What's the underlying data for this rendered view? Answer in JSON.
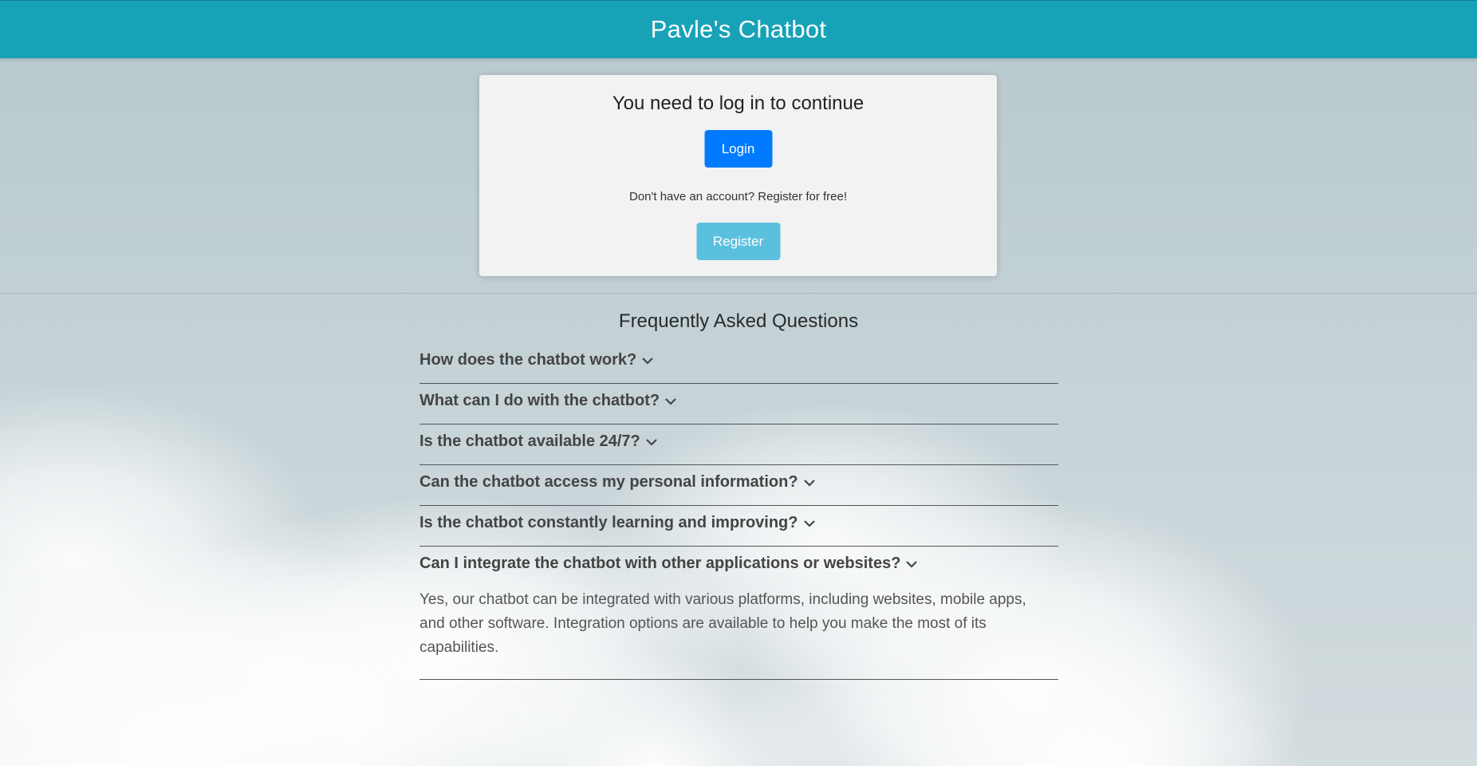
{
  "header": {
    "title": "Pavle's Chatbot",
    "color": "#17a2b8"
  },
  "login_card": {
    "heading": "You need to log in to continue",
    "login_label": "Login",
    "register_prompt": "Don't have an account? Register for free!",
    "register_label": "Register"
  },
  "faq": {
    "title": "Frequently Asked Questions",
    "items": [
      {
        "question": "How does the chatbot work?",
        "expanded": false
      },
      {
        "question": "What can I do with the chatbot?",
        "expanded": false
      },
      {
        "question": "Is the chatbot available 24/7?",
        "expanded": false
      },
      {
        "question": "Can the chatbot access my personal information?",
        "expanded": false
      },
      {
        "question": "Is the chatbot constantly learning and improving?",
        "expanded": false
      },
      {
        "question": "Can I integrate the chatbot with other applications or websites?",
        "expanded": true,
        "answer": "Yes, our chatbot can be integrated with various platforms, including websites, mobile apps, and other software. Integration options are available to help you make the most of its capabilities."
      }
    ]
  },
  "icons": {
    "faq_toggle": "chevron-down-icon"
  },
  "colors": {
    "login_button": "#007bff",
    "register_button": "#5bc0de"
  }
}
